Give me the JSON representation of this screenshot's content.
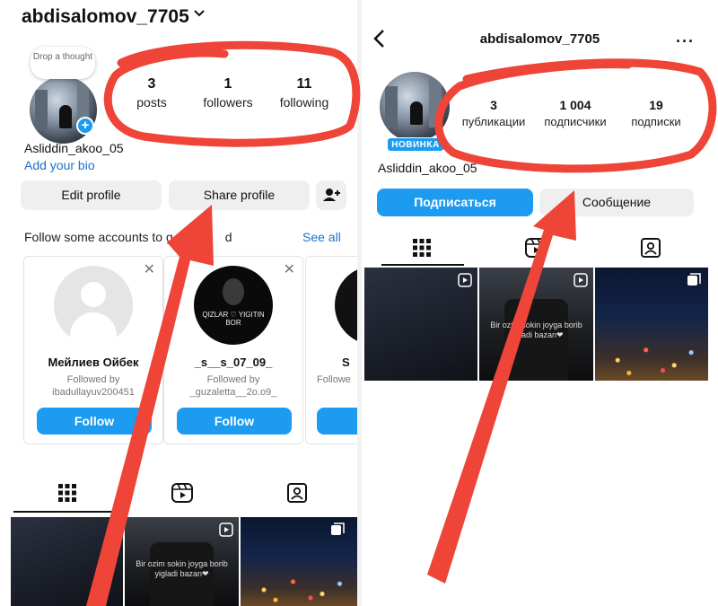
{
  "left_panel": {
    "header": {
      "username": "abdisalomov_7705",
      "chevron_icon": "chevron-down-icon"
    },
    "note": {
      "text": "Drop a thought"
    },
    "stats": [
      {
        "value": "3",
        "label": "posts"
      },
      {
        "value": "1",
        "label": "followers"
      },
      {
        "value": "11",
        "label": "following"
      }
    ],
    "profile": {
      "display_name": "Asliddin_akoo_05",
      "bio_link": "Add your bio"
    },
    "buttons": {
      "edit": "Edit profile",
      "share": "Share profile"
    },
    "suggestions": {
      "title": "Follow some accounts to g",
      "title_tail": "d",
      "see_all": "See all",
      "cards": [
        {
          "name": "Мейлиев Ойбек",
          "followed_by_label": "Followed by",
          "followed_by": "ibadullayuv200451",
          "button": "Follow"
        },
        {
          "name": "_s__s_07_09_",
          "followed_by_label": "Followed by",
          "followed_by": "_guzaletta__2o.o9_",
          "button": "Follow",
          "avatar_text": "QIZLAR ♡ YIGITIN BOR"
        },
        {
          "name": "S",
          "followed_by_label": "Followe",
          "followed_by": "",
          "button": ""
        }
      ]
    },
    "post_texts": {
      "shirt_caption": "Bir ozim sokin joyga borib yigladi bazan❤"
    }
  },
  "right_panel": {
    "header": {
      "username": "abdisalomov_7705",
      "more_label": "···"
    },
    "new_badge": "НОВИНКА",
    "stats": [
      {
        "value": "3",
        "label": "публикации"
      },
      {
        "value": "1 004",
        "label": "подписчики"
      },
      {
        "value": "19",
        "label": "подписки"
      }
    ],
    "profile": {
      "display_name": "Asliddin_akoo_05"
    },
    "buttons": {
      "subscribe": "Подписаться",
      "message": "Сообщение"
    },
    "post_texts": {
      "shirt_caption": "Bir ozim sokin joyga borib yigladi bazan❤"
    }
  },
  "colors": {
    "accent": "#1d9bf0",
    "annotation": "#ef4438"
  }
}
